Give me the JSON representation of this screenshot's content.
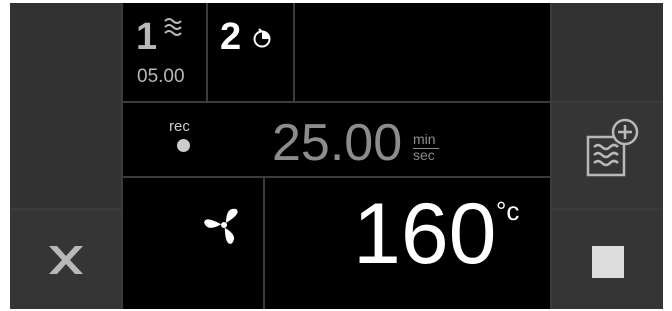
{
  "program": {
    "step1_number": "1",
    "step1_time": "05.00",
    "step2_number": "2",
    "step1_icon": "steam-waves-icon",
    "step2_icon": "timer-clock-icon"
  },
  "timer": {
    "rec_label": "rec",
    "rec_indicator": "record-dot-icon",
    "value": "25.00",
    "unit_top": "min",
    "unit_bottom": "sec"
  },
  "fan": {
    "icon": "fan-icon"
  },
  "temperature": {
    "value": "160",
    "unit": "°c"
  },
  "buttons": {
    "cancel_icon": "cancel-x-icon",
    "add_step_icon": "add-steam-step-icon",
    "stop_icon": "stop-square-icon"
  },
  "colors": {
    "background": "#000000",
    "side_panel": "#323232",
    "divider": "#3b3b3b",
    "text_dim": "#b8b8b8",
    "text_bright": "#ffffff"
  }
}
